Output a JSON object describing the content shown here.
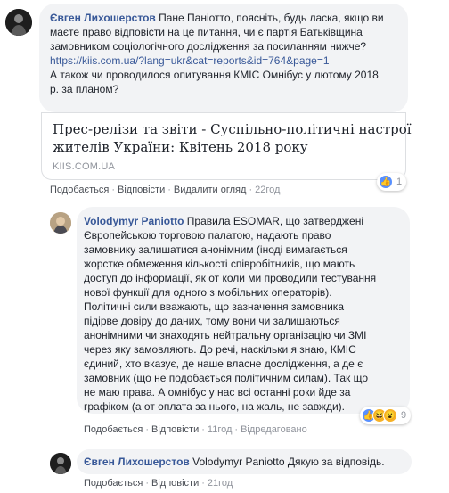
{
  "comments": [
    {
      "author": "Євген Лихошерстов",
      "text_lines": [
        "Пане Паніотто, поясніть, будь ласка, якщо ви",
        "маєте право відповісти на це питання, чи є партія Батьківщина",
        "замовником соціологічного дослідження за посиланням нижче?"
      ],
      "link_text": "https://kiis.com.ua/?lang=ukr&cat=reports&id=764&page=1",
      "text_lines_2": [
        "А також чи проводилося опитування КМІС Омнібус у лютому 2018",
        "р. за планом?"
      ],
      "preview": {
        "title_lines": [
          "Прес-релізи та звіти - Суспільно-політичні настрої",
          "жителів України: Квітень 2018 року"
        ],
        "domain": "KIIS.COM.UA"
      },
      "actions": [
        "Подобається",
        "Відповісти",
        "Видалити огляд"
      ],
      "time": "22год",
      "reaction_count": "1"
    },
    {
      "author": "Volodymyr Paniotto",
      "text_lines": [
        "Правила ESOMAR, що затверджені",
        "Європейською торговою палатою, надають право",
        "замовнику залишатися анонімним (іноді вимагається",
        "жорстке обмеження кількості співробітників, що мають",
        "доступ до інформації, як от коли ми проводили тестування",
        "нової функції для одного з мобільних операторів).",
        "Політичні сили вважають, що зазначення замовника",
        "підірве довіру до даних, тому вони чи залишаються",
        "анонімними чи знаходять нейтральну організацію чи ЗМІ",
        "через яку замовляють. До речі, наскільки я знаю, КМІС",
        "єдиний, хто вказує, де наше власне дослідження, а де є",
        "замовник (що не подобається політичним силам). Так що",
        "не маю права. А омнібус у нас всі останні роки йде за",
        "графіком (а от оплата за нього, на жаль, не завжди)."
      ],
      "actions": [
        "Подобається",
        "Відповісти"
      ],
      "time": "11год",
      "extra": "Відредаговано",
      "reaction_count": "9"
    },
    {
      "author": "Євген Лихошерстов",
      "text": "Volodymyr Paniotto Дякую за відповідь.",
      "actions": [
        "Подобається",
        "Відповісти"
      ],
      "time": "21год"
    }
  ],
  "icons": [
    "avatar-photo",
    "like-icon",
    "haha-icon",
    "wow-icon"
  ],
  "colors": {
    "link": "#385898",
    "bubble": "#f2f3f5",
    "like": "#5890ff",
    "haha": "#f7b125"
  }
}
